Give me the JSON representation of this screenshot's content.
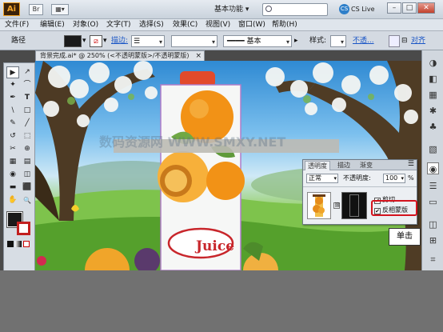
{
  "titlebar": {
    "logo": "Ai",
    "br_label": "Br",
    "workspace": "基本功能",
    "search_placeholder": "",
    "cs_live": "CS Live",
    "minimize": "–",
    "maximize": "□",
    "close": "✕"
  },
  "menu": [
    "文件(F)",
    "编辑(E)",
    "对象(O)",
    "文字(T)",
    "选择(S)",
    "效果(C)",
    "视图(V)",
    "窗口(W)",
    "帮助(H)"
  ],
  "controlbar": {
    "selection_label": "路径",
    "stroke_label": "描边:",
    "profile_label": "基本",
    "style_label": "样式:",
    "opacity_label": "不透...",
    "align_label": "对齐"
  },
  "document_tab": {
    "title": "背景完成.ai* @ 250% (<不透明蒙版>/不透明蒙版)",
    "close": "×"
  },
  "tools": [
    "▶",
    "↗",
    "✦",
    "⌒",
    "✒",
    "T",
    "\\",
    "□",
    "✎",
    "╱",
    "↺",
    "⬚",
    "✂",
    "⊕",
    "▦",
    "▤",
    "◉",
    "◫",
    "▬",
    "⬛",
    "✋",
    "🔍"
  ],
  "artwork": {
    "brand_text": "Juice",
    "watermark": "数码资源网 WWW.SMXY.NET"
  },
  "transparency_panel": {
    "tabs": [
      "透明度",
      "描边",
      "渐变"
    ],
    "blend_mode": "正常",
    "opacity_label": "不透明度:",
    "opacity_value": "100",
    "percent": "%",
    "clip_label": "剪切",
    "invert_label": "反相蒙版",
    "clip_checked": true,
    "invert_checked": true
  },
  "callout": {
    "text": "单击"
  },
  "colors": {
    "highlight": "#d4141e",
    "link": "#1a56c6"
  }
}
